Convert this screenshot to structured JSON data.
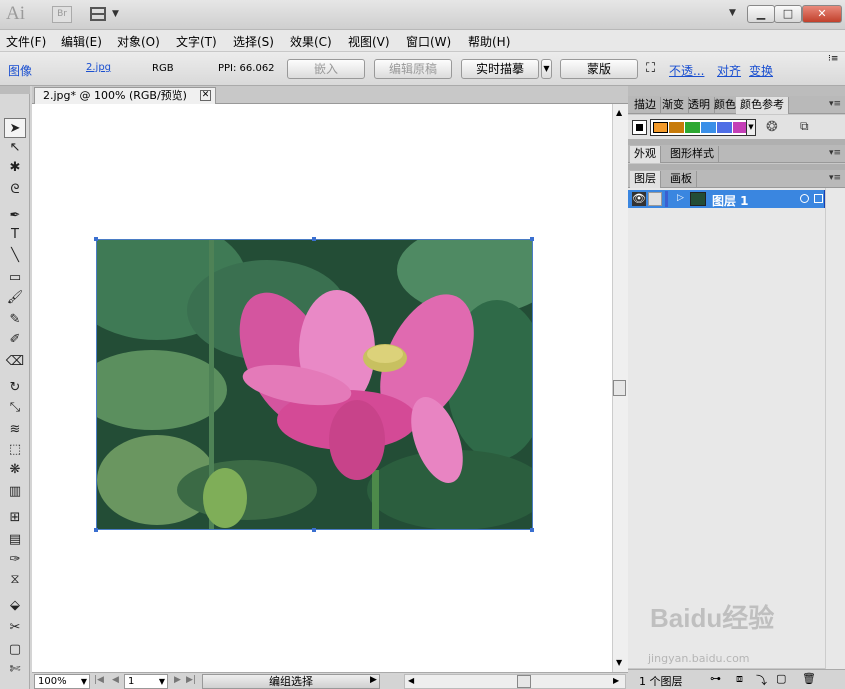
{
  "titlebar": {
    "app_logo": "Ai",
    "bridge": "Br"
  },
  "menus": [
    "文件(F)",
    "编辑(E)",
    "对象(O)",
    "文字(T)",
    "选择(S)",
    "效果(C)",
    "视图(V)",
    "窗口(W)",
    "帮助(H)"
  ],
  "control": {
    "type_label": "图像",
    "filename": "2.jpg",
    "color_mode": "RGB",
    "ppi": "PPI: 66.062",
    "embed": "嵌入",
    "edit_original": "编辑原稿",
    "live_trace": "实时描摹",
    "mask": "蒙版",
    "opacity": "不透...",
    "align": "对齐",
    "transform": "变换"
  },
  "document": {
    "tab_title": "2.jpg* @ 100% (RGB/预览)"
  },
  "tools": [
    "selection",
    "direct-selection",
    "magic-wand",
    "lasso",
    "pen",
    "type",
    "line",
    "rectangle",
    "paintbrush",
    "pencil",
    "blob-brush",
    "eraser",
    "rotate",
    "scale",
    "warp",
    "free-transform",
    "symbol-sprayer",
    "column-graph",
    "mesh",
    "gradient",
    "eyedropper",
    "blend",
    "live-paint",
    "slice",
    "artboard",
    "scissors"
  ],
  "status": {
    "zoom": "100%",
    "artboard_num": "1",
    "info": "编组选择"
  },
  "panels": {
    "color_tabs": [
      "描边",
      "渐变",
      "透明",
      "颜色",
      "颜色参考"
    ],
    "swatch_colors": [
      "#f39a2a",
      "#c77b0a",
      "#2da832",
      "#3a8fe8",
      "#4f6ee6",
      "#c43fb7"
    ],
    "appearance_tabs": [
      "外观",
      "图形样式"
    ],
    "layers_tabs": [
      "图层",
      "画板"
    ],
    "layer_name": "图层 1",
    "layers_count": "1 个图层"
  },
  "watermark": {
    "brand": "Baidu经验",
    "url": "jingyan.baidu.com"
  }
}
